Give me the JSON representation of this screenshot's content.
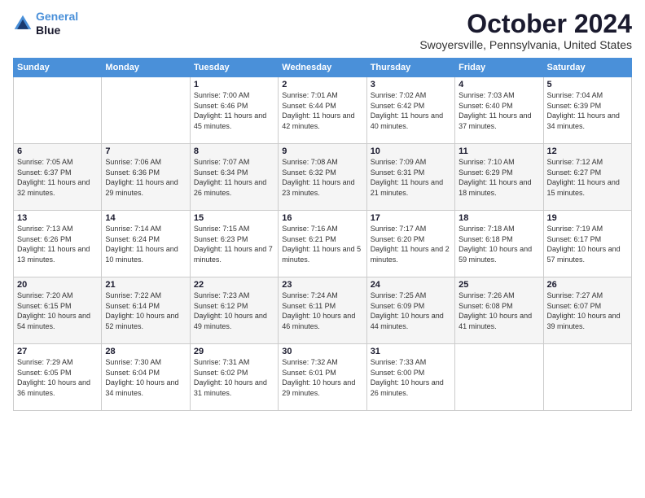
{
  "logo": {
    "line1": "General",
    "line2": "Blue"
  },
  "header": {
    "month": "October 2024",
    "location": "Swoyersville, Pennsylvania, United States"
  },
  "weekdays": [
    "Sunday",
    "Monday",
    "Tuesday",
    "Wednesday",
    "Thursday",
    "Friday",
    "Saturday"
  ],
  "weeks": [
    [
      {
        "day": "",
        "sunrise": "",
        "sunset": "",
        "daylight": ""
      },
      {
        "day": "",
        "sunrise": "",
        "sunset": "",
        "daylight": ""
      },
      {
        "day": "1",
        "sunrise": "Sunrise: 7:00 AM",
        "sunset": "Sunset: 6:46 PM",
        "daylight": "Daylight: 11 hours and 45 minutes."
      },
      {
        "day": "2",
        "sunrise": "Sunrise: 7:01 AM",
        "sunset": "Sunset: 6:44 PM",
        "daylight": "Daylight: 11 hours and 42 minutes."
      },
      {
        "day": "3",
        "sunrise": "Sunrise: 7:02 AM",
        "sunset": "Sunset: 6:42 PM",
        "daylight": "Daylight: 11 hours and 40 minutes."
      },
      {
        "day": "4",
        "sunrise": "Sunrise: 7:03 AM",
        "sunset": "Sunset: 6:40 PM",
        "daylight": "Daylight: 11 hours and 37 minutes."
      },
      {
        "day": "5",
        "sunrise": "Sunrise: 7:04 AM",
        "sunset": "Sunset: 6:39 PM",
        "daylight": "Daylight: 11 hours and 34 minutes."
      }
    ],
    [
      {
        "day": "6",
        "sunrise": "Sunrise: 7:05 AM",
        "sunset": "Sunset: 6:37 PM",
        "daylight": "Daylight: 11 hours and 32 minutes."
      },
      {
        "day": "7",
        "sunrise": "Sunrise: 7:06 AM",
        "sunset": "Sunset: 6:36 PM",
        "daylight": "Daylight: 11 hours and 29 minutes."
      },
      {
        "day": "8",
        "sunrise": "Sunrise: 7:07 AM",
        "sunset": "Sunset: 6:34 PM",
        "daylight": "Daylight: 11 hours and 26 minutes."
      },
      {
        "day": "9",
        "sunrise": "Sunrise: 7:08 AM",
        "sunset": "Sunset: 6:32 PM",
        "daylight": "Daylight: 11 hours and 23 minutes."
      },
      {
        "day": "10",
        "sunrise": "Sunrise: 7:09 AM",
        "sunset": "Sunset: 6:31 PM",
        "daylight": "Daylight: 11 hours and 21 minutes."
      },
      {
        "day": "11",
        "sunrise": "Sunrise: 7:10 AM",
        "sunset": "Sunset: 6:29 PM",
        "daylight": "Daylight: 11 hours and 18 minutes."
      },
      {
        "day": "12",
        "sunrise": "Sunrise: 7:12 AM",
        "sunset": "Sunset: 6:27 PM",
        "daylight": "Daylight: 11 hours and 15 minutes."
      }
    ],
    [
      {
        "day": "13",
        "sunrise": "Sunrise: 7:13 AM",
        "sunset": "Sunset: 6:26 PM",
        "daylight": "Daylight: 11 hours and 13 minutes."
      },
      {
        "day": "14",
        "sunrise": "Sunrise: 7:14 AM",
        "sunset": "Sunset: 6:24 PM",
        "daylight": "Daylight: 11 hours and 10 minutes."
      },
      {
        "day": "15",
        "sunrise": "Sunrise: 7:15 AM",
        "sunset": "Sunset: 6:23 PM",
        "daylight": "Daylight: 11 hours and 7 minutes."
      },
      {
        "day": "16",
        "sunrise": "Sunrise: 7:16 AM",
        "sunset": "Sunset: 6:21 PM",
        "daylight": "Daylight: 11 hours and 5 minutes."
      },
      {
        "day": "17",
        "sunrise": "Sunrise: 7:17 AM",
        "sunset": "Sunset: 6:20 PM",
        "daylight": "Daylight: 11 hours and 2 minutes."
      },
      {
        "day": "18",
        "sunrise": "Sunrise: 7:18 AM",
        "sunset": "Sunset: 6:18 PM",
        "daylight": "Daylight: 10 hours and 59 minutes."
      },
      {
        "day": "19",
        "sunrise": "Sunrise: 7:19 AM",
        "sunset": "Sunset: 6:17 PM",
        "daylight": "Daylight: 10 hours and 57 minutes."
      }
    ],
    [
      {
        "day": "20",
        "sunrise": "Sunrise: 7:20 AM",
        "sunset": "Sunset: 6:15 PM",
        "daylight": "Daylight: 10 hours and 54 minutes."
      },
      {
        "day": "21",
        "sunrise": "Sunrise: 7:22 AM",
        "sunset": "Sunset: 6:14 PM",
        "daylight": "Daylight: 10 hours and 52 minutes."
      },
      {
        "day": "22",
        "sunrise": "Sunrise: 7:23 AM",
        "sunset": "Sunset: 6:12 PM",
        "daylight": "Daylight: 10 hours and 49 minutes."
      },
      {
        "day": "23",
        "sunrise": "Sunrise: 7:24 AM",
        "sunset": "Sunset: 6:11 PM",
        "daylight": "Daylight: 10 hours and 46 minutes."
      },
      {
        "day": "24",
        "sunrise": "Sunrise: 7:25 AM",
        "sunset": "Sunset: 6:09 PM",
        "daylight": "Daylight: 10 hours and 44 minutes."
      },
      {
        "day": "25",
        "sunrise": "Sunrise: 7:26 AM",
        "sunset": "Sunset: 6:08 PM",
        "daylight": "Daylight: 10 hours and 41 minutes."
      },
      {
        "day": "26",
        "sunrise": "Sunrise: 7:27 AM",
        "sunset": "Sunset: 6:07 PM",
        "daylight": "Daylight: 10 hours and 39 minutes."
      }
    ],
    [
      {
        "day": "27",
        "sunrise": "Sunrise: 7:29 AM",
        "sunset": "Sunset: 6:05 PM",
        "daylight": "Daylight: 10 hours and 36 minutes."
      },
      {
        "day": "28",
        "sunrise": "Sunrise: 7:30 AM",
        "sunset": "Sunset: 6:04 PM",
        "daylight": "Daylight: 10 hours and 34 minutes."
      },
      {
        "day": "29",
        "sunrise": "Sunrise: 7:31 AM",
        "sunset": "Sunset: 6:02 PM",
        "daylight": "Daylight: 10 hours and 31 minutes."
      },
      {
        "day": "30",
        "sunrise": "Sunrise: 7:32 AM",
        "sunset": "Sunset: 6:01 PM",
        "daylight": "Daylight: 10 hours and 29 minutes."
      },
      {
        "day": "31",
        "sunrise": "Sunrise: 7:33 AM",
        "sunset": "Sunset: 6:00 PM",
        "daylight": "Daylight: 10 hours and 26 minutes."
      },
      {
        "day": "",
        "sunrise": "",
        "sunset": "",
        "daylight": ""
      },
      {
        "day": "",
        "sunrise": "",
        "sunset": "",
        "daylight": ""
      }
    ]
  ]
}
